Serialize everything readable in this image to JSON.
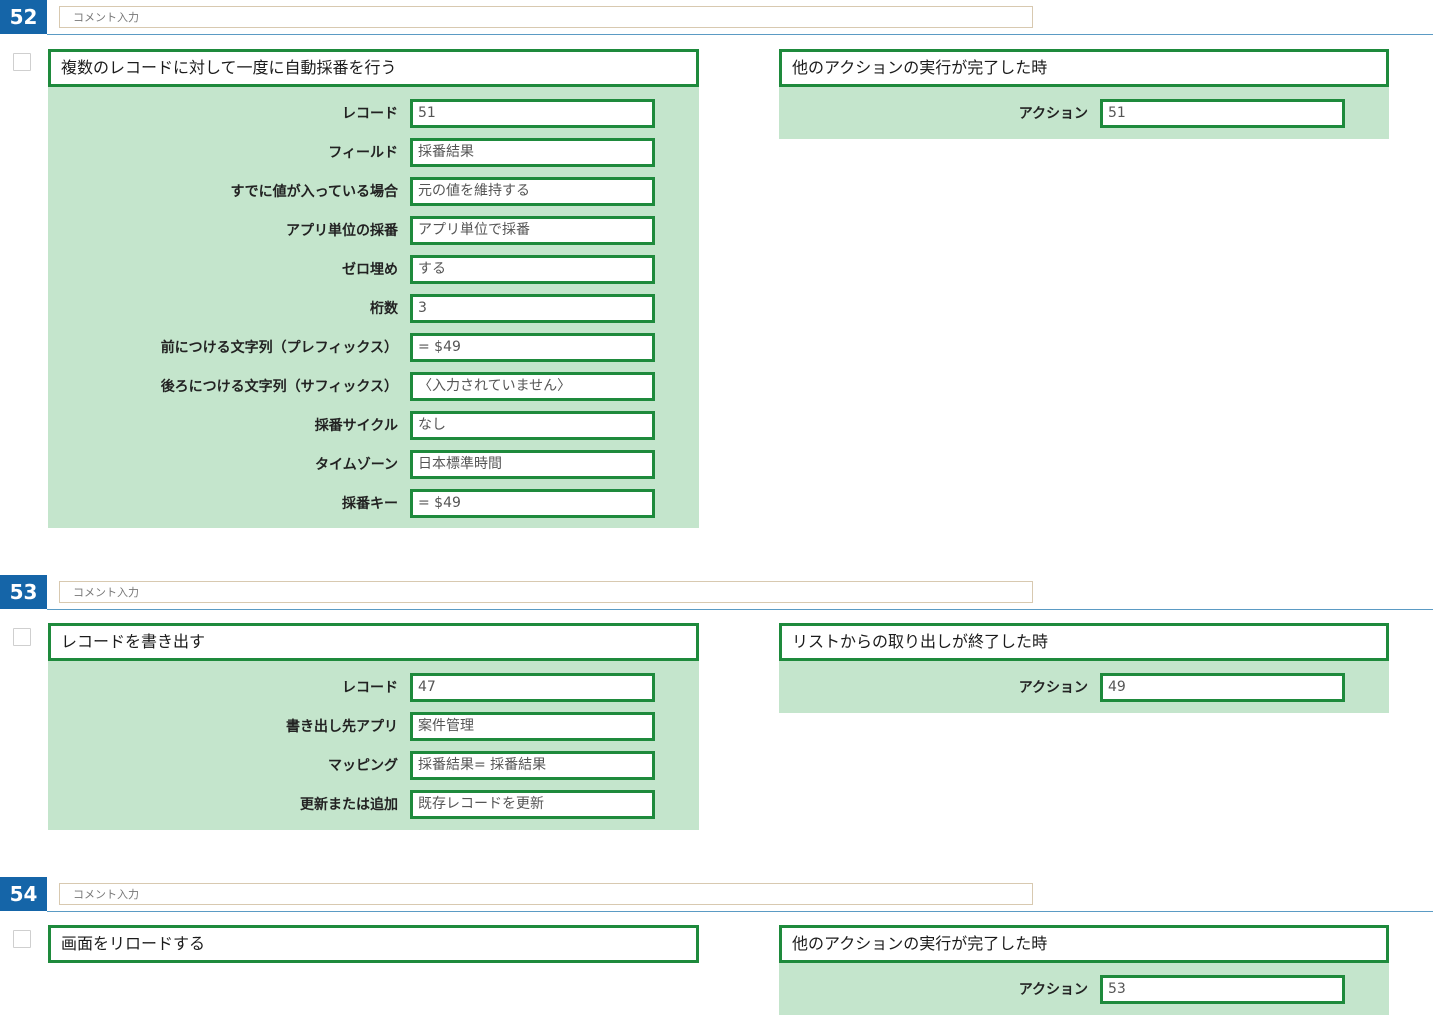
{
  "comment_placeholder": "コメント入力",
  "sections": [
    {
      "number": "52",
      "left_panel": {
        "title": "複数のレコードに対して一度に自動採番を行う",
        "rows": [
          {
            "label": "レコード",
            "value": "51"
          },
          {
            "label": "フィールド",
            "value": "採番結果"
          },
          {
            "label": "すでに値が入っている場合",
            "value": "元の値を維持する"
          },
          {
            "label": "アプリ単位の採番",
            "value": "アプリ単位で採番"
          },
          {
            "label": "ゼロ埋め",
            "value": "する"
          },
          {
            "label": "桁数",
            "value": "3"
          },
          {
            "label": "前につける文字列（プレフィックス）",
            "value": "= $49"
          },
          {
            "label": "後ろにつける文字列（サフィックス）",
            "value": "〈入力されていません〉"
          },
          {
            "label": "採番サイクル",
            "value": "なし"
          },
          {
            "label": "タイムゾーン",
            "value": "日本標準時間"
          },
          {
            "label": "採番キー",
            "value": "= $49"
          }
        ]
      },
      "right_panel": {
        "title": "他のアクションの実行が完了した時",
        "rows": [
          {
            "label": "アクション",
            "value": "51"
          }
        ]
      }
    },
    {
      "number": "53",
      "left_panel": {
        "title": "レコードを書き出す",
        "rows": [
          {
            "label": "レコード",
            "value": "47"
          },
          {
            "label": "書き出し先アプリ",
            "value": "案件管理"
          },
          {
            "label": "マッピング",
            "value": "採番結果= 採番結果"
          },
          {
            "label": "更新または追加",
            "value": "既存レコードを更新"
          }
        ]
      },
      "right_panel": {
        "title": "リストからの取り出しが終了した時",
        "rows": [
          {
            "label": "アクション",
            "value": "49"
          }
        ]
      }
    },
    {
      "number": "54",
      "left_panel": {
        "title": "画面をリロードする",
        "rows": []
      },
      "right_panel": {
        "title": "他のアクションの実行が完了した時",
        "rows": [
          {
            "label": "アクション",
            "value": "53"
          }
        ]
      }
    }
  ]
}
